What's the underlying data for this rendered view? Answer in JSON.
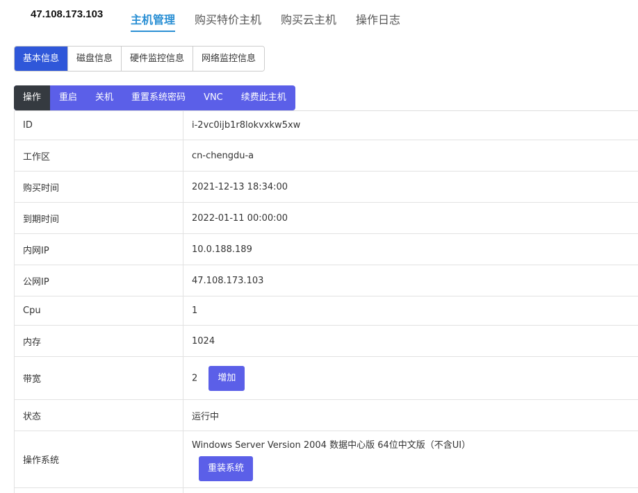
{
  "header": {
    "host_ip": "47.108.173.103"
  },
  "nav": {
    "items": [
      {
        "label": "主机管理"
      },
      {
        "label": "购买特价主机"
      },
      {
        "label": "购买云主机"
      },
      {
        "label": "操作日志"
      }
    ],
    "active": "主机管理"
  },
  "tabs": {
    "items": [
      {
        "label": "基本信息"
      },
      {
        "label": "磁盘信息"
      },
      {
        "label": "硬件监控信息"
      },
      {
        "label": "网络监控信息"
      }
    ],
    "active": "基本信息"
  },
  "ops": {
    "items": [
      {
        "label": "操作"
      },
      {
        "label": "重启"
      },
      {
        "label": "关机"
      },
      {
        "label": "重置系统密码"
      },
      {
        "label": "VNC"
      },
      {
        "label": "续费此主机"
      }
    ]
  },
  "info": {
    "id": {
      "label": "ID",
      "value": "i-2vc0ijb1r8lokvxkw5xw"
    },
    "zone": {
      "label": "工作区",
      "value": "cn-chengdu-a"
    },
    "purchase_time": {
      "label": "购买时间",
      "value": "2021-12-13 18:34:00"
    },
    "expire_time": {
      "label": "到期时间",
      "value": "2022-01-11 00:00:00"
    },
    "private_ip": {
      "label": "内网IP",
      "value": "10.0.188.189"
    },
    "public_ip": {
      "label": "公网IP",
      "value": "47.108.173.103"
    },
    "cpu": {
      "label": "Cpu",
      "value": "1"
    },
    "memory": {
      "label": "内存",
      "value": "1024"
    },
    "bandwidth": {
      "label": "带宽",
      "value": "2",
      "button": "增加"
    },
    "status": {
      "label": "状态",
      "value": "运行中"
    },
    "os": {
      "label": "操作系统",
      "value": "Windows Server Version 2004 数据中心版 64位中文版（不含UI）",
      "button": "重装系统"
    }
  },
  "colors": {
    "primary": "#5b5fe8",
    "tab_active": "#2f57d9",
    "nav_active": "#2a8fd4",
    "op_dark": "#353a40"
  }
}
